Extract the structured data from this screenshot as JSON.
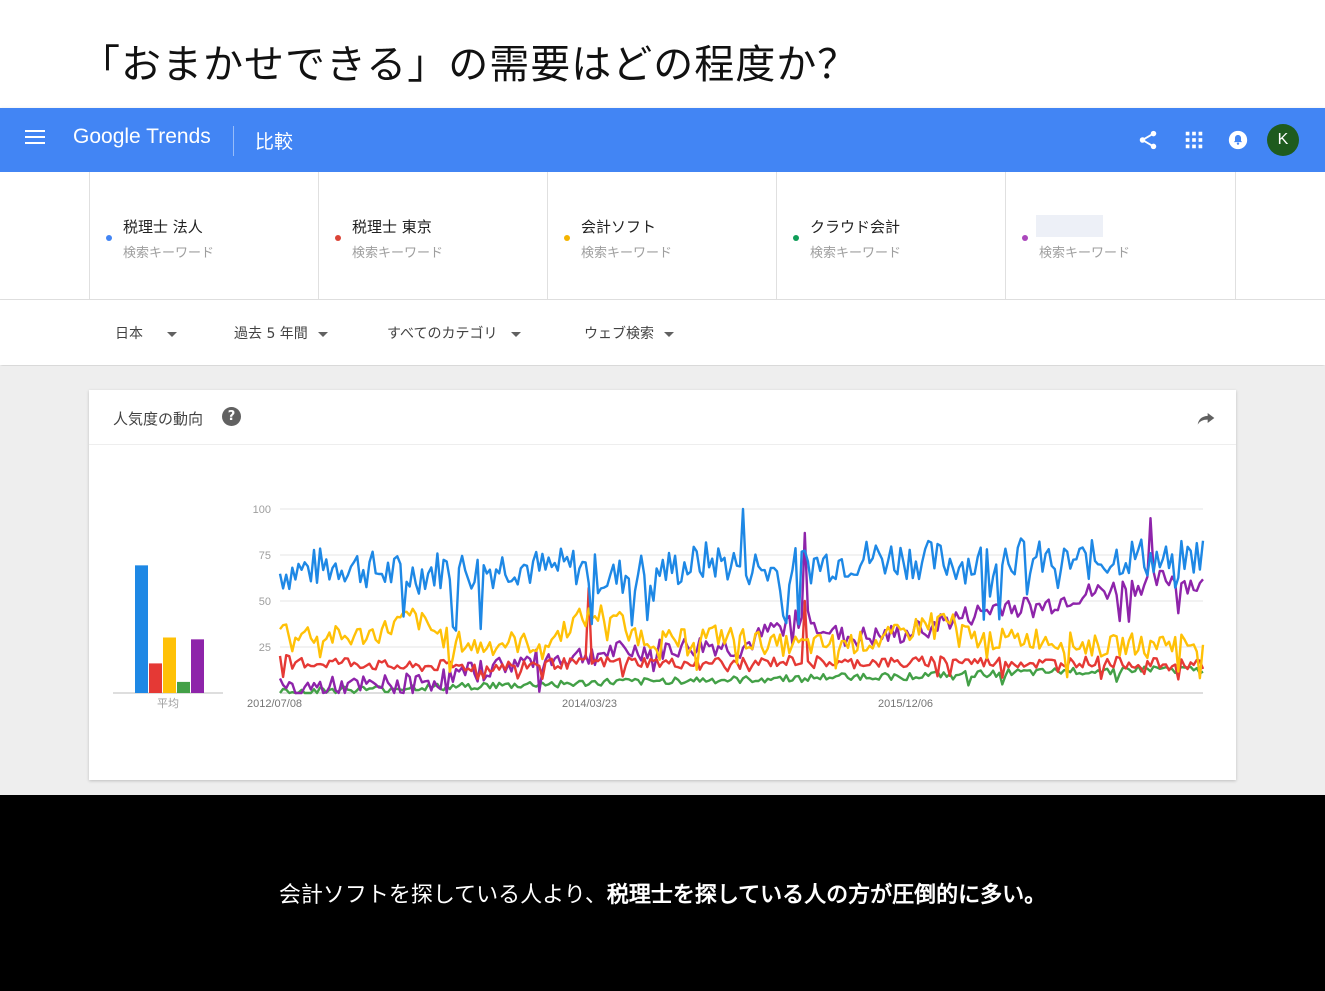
{
  "slide": {
    "title": "「おまかせできる」の需要はどの程度か？",
    "footer_normal": "会計ソフトを探している人より、",
    "footer_bold": "税理士を探している人の方が圧倒的に多い。"
  },
  "appbar": {
    "logo": "Google Trends",
    "section": "比較",
    "avatar_initial": "K",
    "icons": [
      "menu-icon",
      "share-icon",
      "apps-grid-icon",
      "notifications-icon"
    ]
  },
  "terms": [
    {
      "name": "税理士 法人",
      "sub": "検索キーワード",
      "color": "#4285f4"
    },
    {
      "name": "税理士 東京",
      "sub": "検索キーワード",
      "color": "#db4437"
    },
    {
      "name": "会計ソフト",
      "sub": "検索キーワード",
      "color": "#f4b400"
    },
    {
      "name": "クラウド会計",
      "sub": "検索キーワード",
      "color": "#0f9d58"
    },
    {
      "name": "",
      "sub": "検索キーワード",
      "color": "#ab47bc",
      "redacted": true
    }
  ],
  "filters": {
    "region": "日本",
    "period": "過去 5 年間",
    "category": "すべてのカテゴリ",
    "search_type": "ウェブ検索"
  },
  "card": {
    "title": "人気度の動向",
    "help": "?"
  },
  "chart_data": {
    "type": "line",
    "ylim": [
      0,
      100
    ],
    "yticks": [
      25,
      50,
      75,
      100
    ],
    "xtick_labels": [
      "2012/07/08",
      "2014/03/23",
      "2015/12/06"
    ],
    "average_label": "平均",
    "averages": [
      {
        "color": "#1e88e5",
        "value": 69
      },
      {
        "color": "#e53935",
        "value": 16
      },
      {
        "color": "#ffc107",
        "value": 30
      },
      {
        "color": "#43a047",
        "value": 6
      },
      {
        "color": "#8e24aa",
        "value": 29
      }
    ],
    "series": [
      {
        "color": "#1e88e5",
        "base": [
          65,
          68,
          70,
          66,
          64,
          68,
          66,
          70,
          67,
          69,
          62,
          66,
          68,
          72,
          70,
          66,
          70,
          72,
          74,
          73,
          72,
          70,
          76,
          72,
          71,
          73,
          75,
          70,
          76
        ],
        "amp": 11
      },
      {
        "color": "#ffc107",
        "base": [
          35,
          32,
          30,
          33,
          42,
          30,
          25,
          28,
          26,
          40,
          44,
          30,
          28,
          32,
          30,
          26,
          26,
          27,
          28,
          33,
          42,
          30,
          29,
          30,
          27,
          25,
          27,
          28,
          27
        ],
        "amp": 6
      },
      {
        "color": "#e53935",
        "base": [
          18,
          16,
          17,
          15,
          14,
          15,
          14,
          15,
          16,
          16,
          17,
          17,
          16,
          17,
          16,
          17,
          18,
          16,
          17,
          16,
          18,
          17,
          17,
          16,
          17,
          17,
          16,
          16,
          16
        ],
        "amp": 3
      },
      {
        "color": "#8e24aa",
        "base": [
          2,
          3,
          3,
          4,
          5,
          8,
          12,
          16,
          18,
          20,
          22,
          23,
          24,
          26,
          24,
          35,
          42,
          30,
          30,
          32,
          38,
          42,
          48,
          46,
          52,
          55,
          58,
          62,
          57
        ],
        "amp": 6
      },
      {
        "color": "#43a047",
        "base": [
          1,
          1,
          2,
          2,
          3,
          3,
          4,
          4,
          5,
          5,
          6,
          6,
          7,
          7,
          7,
          8,
          8,
          9,
          9,
          9,
          10,
          10,
          11,
          11,
          12,
          12,
          13,
          13,
          12
        ],
        "amp": 2
      }
    ],
    "spikes": [
      {
        "series": 0,
        "at": 150,
        "value": 100
      },
      {
        "series": 3,
        "at": 170,
        "value": 87
      },
      {
        "series": 0,
        "at": 164,
        "value": 38
      },
      {
        "series": 3,
        "at": 282,
        "value": 95
      },
      {
        "series": 2,
        "at": 100,
        "value": 57
      },
      {
        "series": 2,
        "at": 170,
        "value": 50
      }
    ],
    "points": 300
  }
}
